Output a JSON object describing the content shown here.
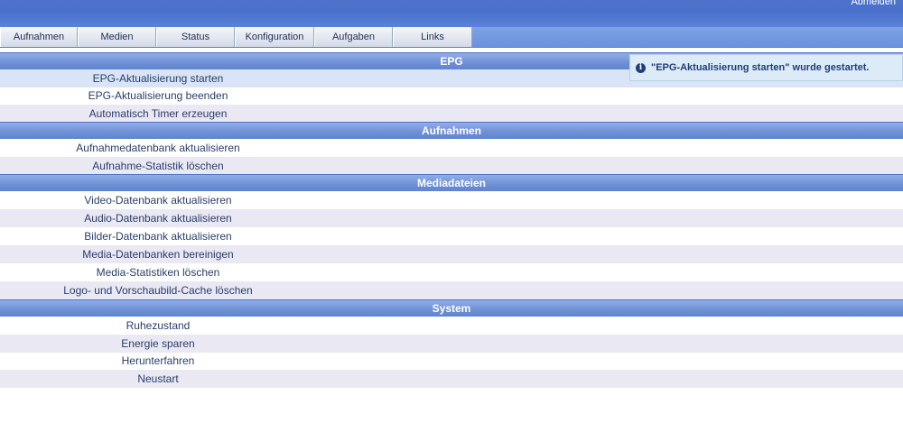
{
  "header": {
    "logout_label": "Abmelden"
  },
  "nav": {
    "tabs": [
      {
        "label": "Aufnahmen"
      },
      {
        "label": "Medien"
      },
      {
        "label": "Status"
      },
      {
        "label": "Konfiguration"
      },
      {
        "label": "Aufgaben"
      },
      {
        "label": "Links"
      }
    ]
  },
  "sections": [
    {
      "title": "EPG",
      "items": [
        "EPG-Aktualisierung starten",
        "EPG-Aktualisierung beenden",
        "Automatisch Timer erzeugen"
      ]
    },
    {
      "title": "Aufnahmen",
      "items": [
        "Aufnahmedatenbank aktualisieren",
        "Aufnahme-Statistik löschen"
      ]
    },
    {
      "title": "Mediadateien",
      "items": [
        "Video-Datenbank aktualisieren",
        "Audio-Datenbank aktualisieren",
        "Bilder-Datenbank aktualisieren",
        "Media-Datenbanken bereinigen",
        "Media-Statistiken löschen",
        "Logo- und Vorschaubild-Cache löschen"
      ]
    },
    {
      "title": "System",
      "items": [
        "Ruhezustand",
        "Energie sparen",
        "Herunterfahren",
        "Neustart"
      ]
    }
  ],
  "notice": {
    "icon": "info-icon",
    "text": "\"EPG-Aktualisierung starten\" wurde gestartet."
  }
}
